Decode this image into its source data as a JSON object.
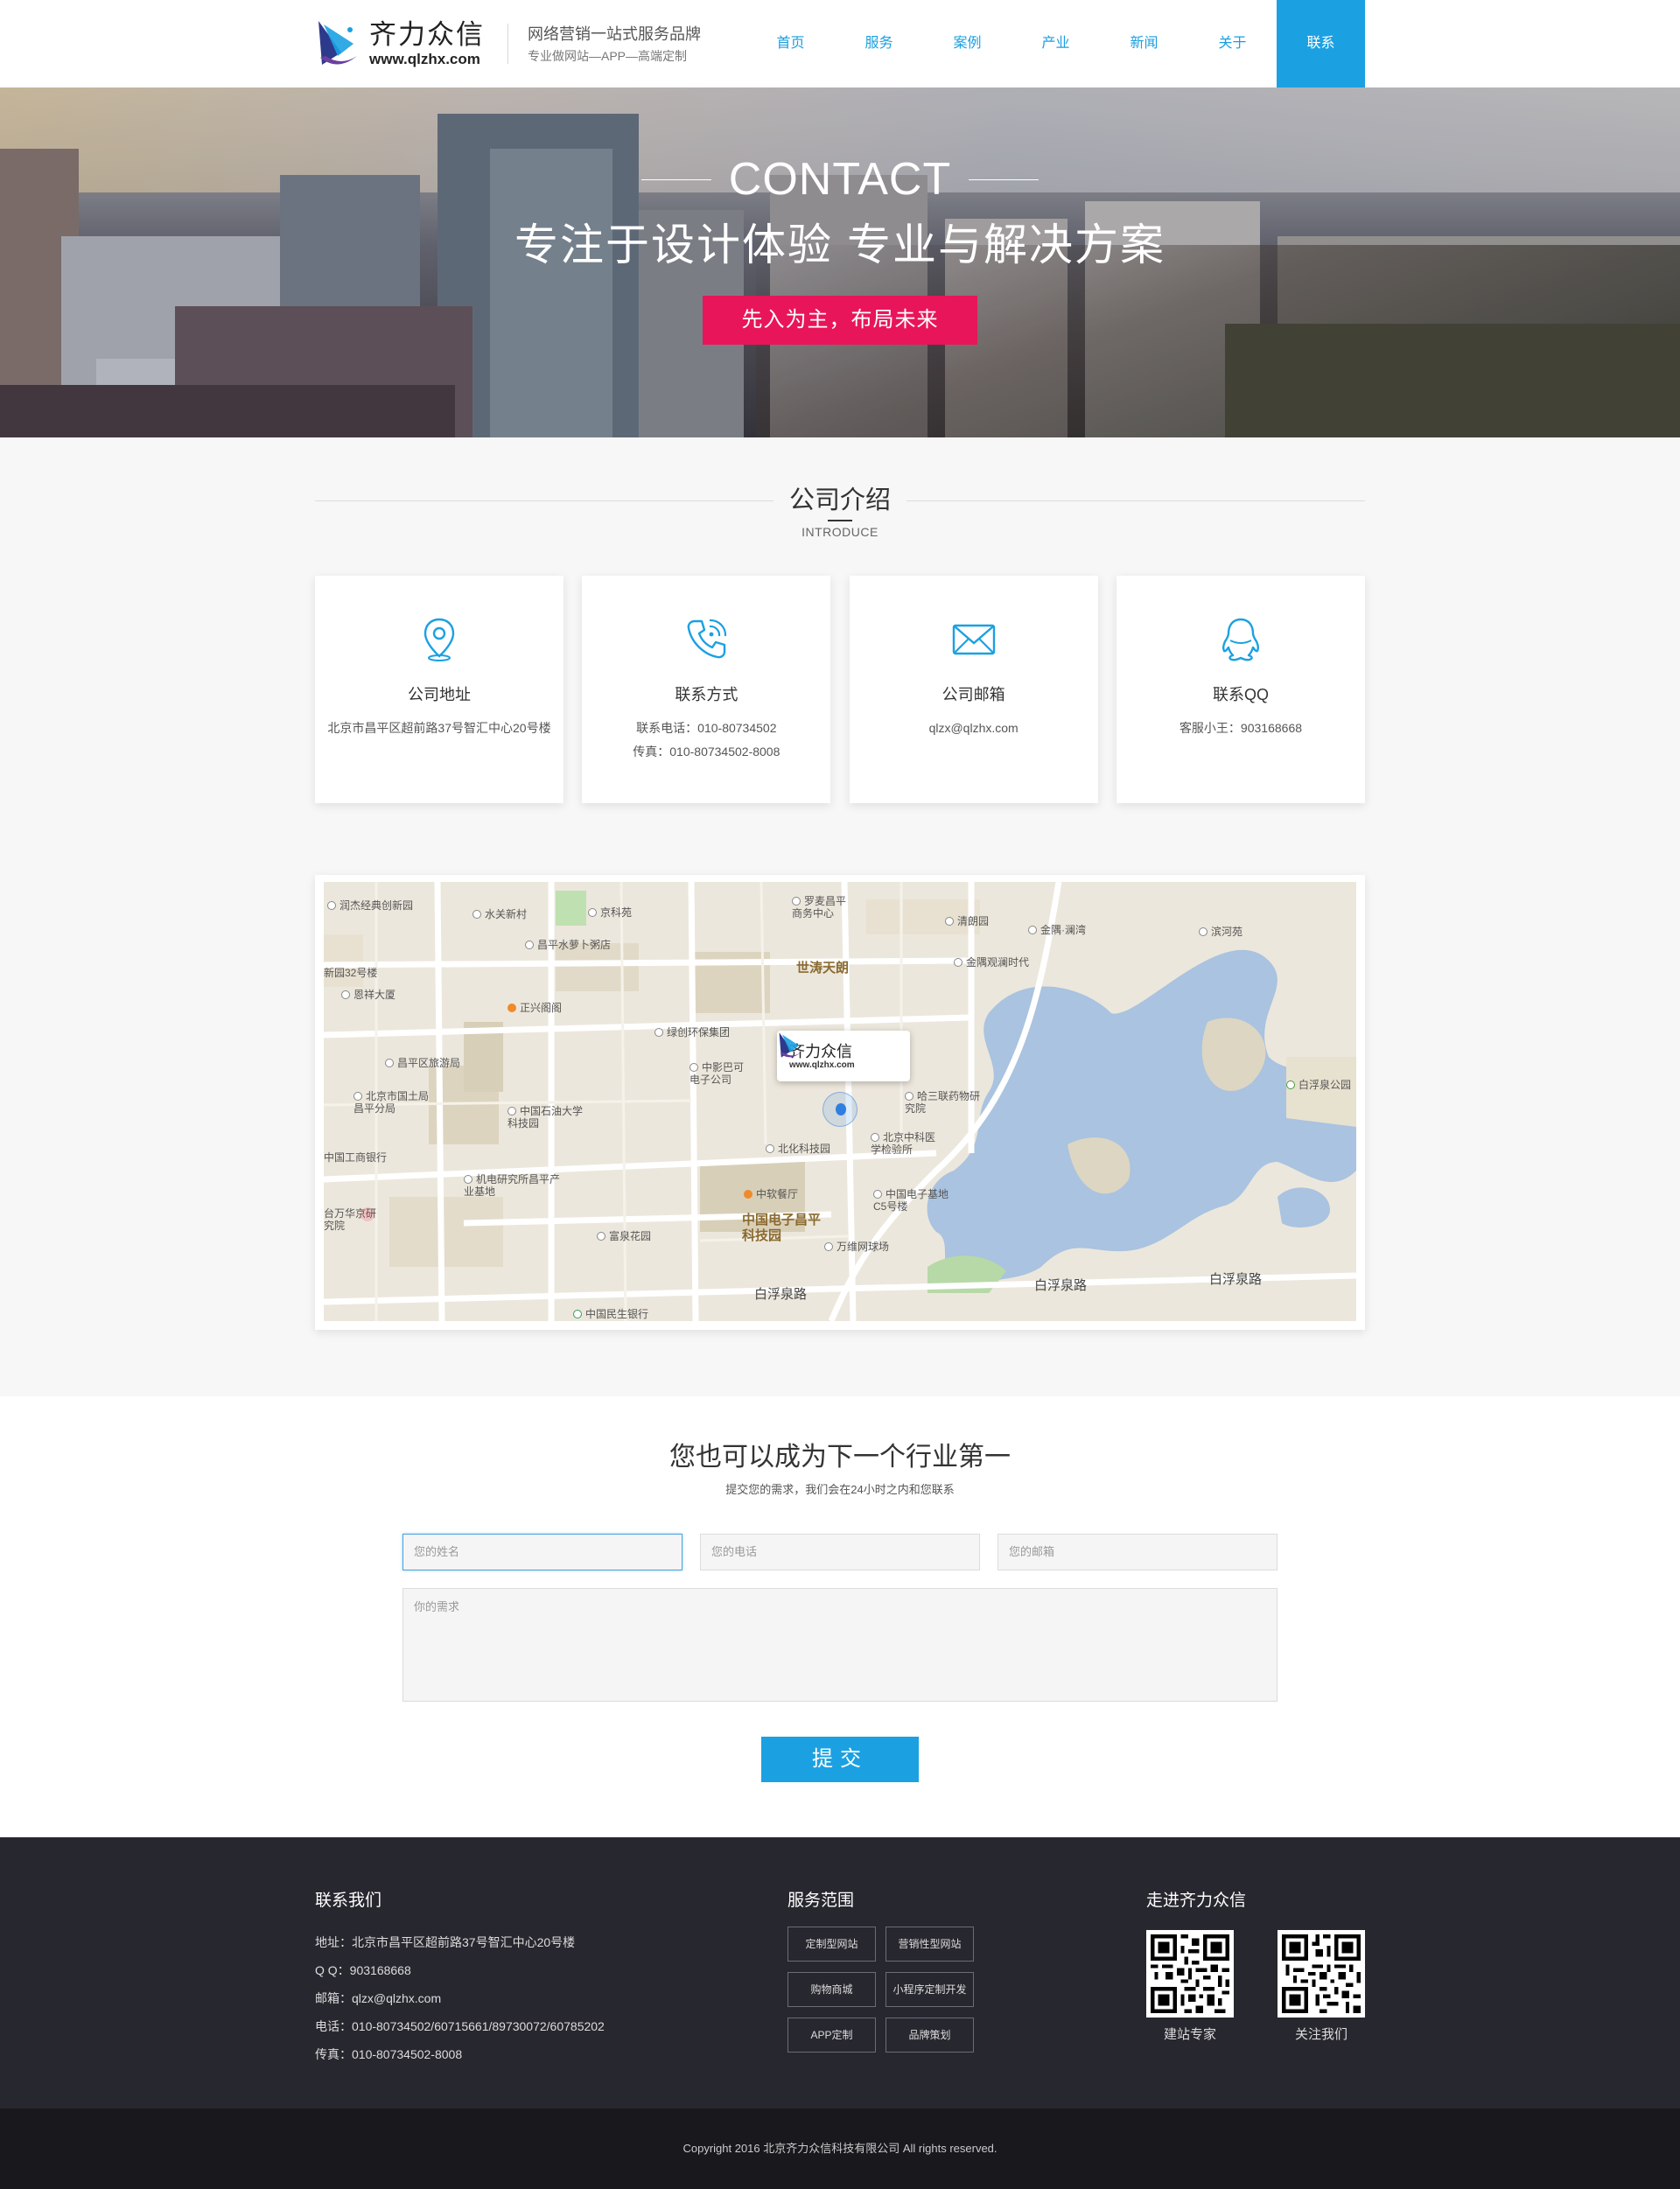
{
  "header": {
    "logo_name": "齐力众信",
    "logo_url": "www.qlzhx.com",
    "slogan_1": "网络营销一站式服务品牌",
    "slogan_2": "专业做网站—APP—高端定制",
    "nav": [
      "首页",
      "服务",
      "案例",
      "产业",
      "新闻",
      "关于",
      "联系"
    ],
    "nav_active": "联系",
    "accent": "#1ba1e2"
  },
  "banner": {
    "en": "CONTACT",
    "cn": "专注于设计体验  专业与解决方案",
    "button": "先入为主，布局未来",
    "button_color": "#e8155a"
  },
  "intro": {
    "title": "公司介绍",
    "subtitle": "INTRODUCE",
    "cards": [
      {
        "icon": "location-pin-icon",
        "title": "公司地址",
        "lines": [
          "北京市昌平区超前路37号智汇中心20号楼"
        ]
      },
      {
        "icon": "phone-icon",
        "title": "联系方式",
        "lines": [
          "联系电话：010-80734502",
          "传真：010-80734502-8008"
        ]
      },
      {
        "icon": "mail-icon",
        "title": "公司邮箱",
        "lines": [
          "qlzx@qlzhx.com"
        ]
      },
      {
        "icon": "qq-icon",
        "title": "联系QQ",
        "lines": [
          "客服小王：903168668"
        ]
      }
    ]
  },
  "map": {
    "pin_name": "齐力众信",
    "pin_url": "www.qlzhx.com",
    "labels": {
      "l1": "润杰经典创新园",
      "l2": "水关新村",
      "l3": "京科苑",
      "l4": "罗麦昌平商务中心",
      "l5": "清朗园",
      "l6": "金隅·澜湾",
      "l7": "滨河苑",
      "l8": "昌平水萝卜粥店",
      "l9": "世涛天朗",
      "l10": "金隅观澜时代",
      "l11": "新园32号楼",
      "l12": "恩祥大厦",
      "l13": "正兴阁阁",
      "l14": "绿创环保集团",
      "l15": "昌平区旅游局",
      "l16": "中影巴可电子公司",
      "l17": "北京市国土局昌平分局",
      "l18": "中国石油大学科技园",
      "l19": "哈三联药物研究院",
      "l20": "白浮泉公园",
      "l21": "中国工商银行",
      "l22": "北化科技园",
      "l23": "北京中科医学检验所",
      "l24": "机电研究所昌平产业基地",
      "l25": "中软餐厅",
      "l26": "中国电子基地C5号楼",
      "l27": "台万华京研究院",
      "l28": "中国电子昌平科技园",
      "l29": "富泉花园",
      "l30": "万维网球场",
      "road1": "白浮泉路",
      "road2": "白浮泉路",
      "road3": "白浮泉路",
      "l31": "中国民生银行"
    }
  },
  "form": {
    "title": "您也可以成为下一个行业第一",
    "subtitle": "提交您的需求，我们会在24小时之内和您联系",
    "name_placeholder": "您的姓名",
    "phone_placeholder": "您的电话",
    "email_placeholder": "您的邮箱",
    "need_placeholder": "你的需求",
    "submit": "提交"
  },
  "footer": {
    "contact_title": "联系我们",
    "contact_lines": [
      "地址：北京市昌平区超前路37号智汇中心20号楼",
      "Q Q：903168668",
      "邮箱：qlzx@qlzhx.com",
      "电话：010-80734502/60715661/89730072/60785202",
      "传真：010-80734502-8008"
    ],
    "service_title": "服务范围",
    "services": [
      "定制型网站",
      "营销性型网站",
      "购物商城",
      "小程序定制开发",
      "APP定制",
      "品牌策划"
    ],
    "about_title": "走进齐力众信",
    "qr1_label": "建站专家",
    "qr2_label": "关注我们",
    "copyright": "Copyright 2016 北京齐力众信科技有限公司 All rights reserved."
  }
}
